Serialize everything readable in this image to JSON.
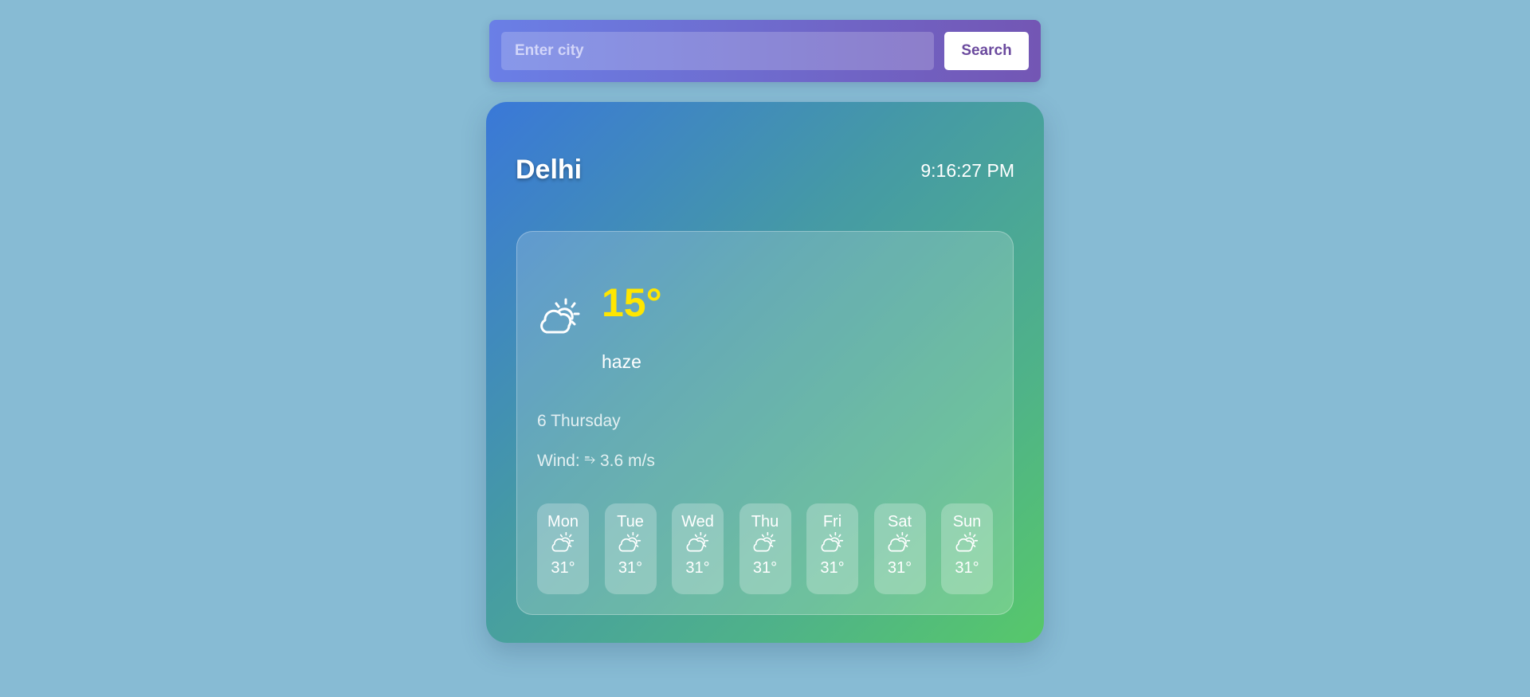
{
  "search": {
    "placeholder": "Enter city",
    "value": "",
    "button_label": "Search"
  },
  "weather": {
    "city": "Delhi",
    "time": "9:16:27 PM",
    "temperature": "15°",
    "condition": "haze",
    "condition_icon": "cloud-sun-icon",
    "date": "6 Thursday",
    "wind_label": "Wind:",
    "wind_icon": "wind-icon",
    "wind_speed": "3.6 m/s"
  },
  "forecast": [
    {
      "day": "Mon",
      "temp": "31°",
      "icon": "cloud-sun-icon"
    },
    {
      "day": "Tue",
      "temp": "31°",
      "icon": "cloud-sun-icon"
    },
    {
      "day": "Wed",
      "temp": "31°",
      "icon": "cloud-sun-icon"
    },
    {
      "day": "Thu",
      "temp": "31°",
      "icon": "cloud-sun-icon"
    },
    {
      "day": "Fri",
      "temp": "31°",
      "icon": "cloud-sun-icon"
    },
    {
      "day": "Sat",
      "temp": "31°",
      "icon": "cloud-sun-icon"
    },
    {
      "day": "Sun",
      "temp": "31°",
      "icon": "cloud-sun-icon"
    }
  ],
  "colors": {
    "page_background": "#87bbd4",
    "search_gradient_start": "#6a7fe6",
    "search_gradient_end": "#7356b4",
    "search_button_text": "#6b4a9e",
    "card_gradient_start": "#3a78d8",
    "card_gradient_end": "#57c86a",
    "temperature": "#ffe600"
  }
}
